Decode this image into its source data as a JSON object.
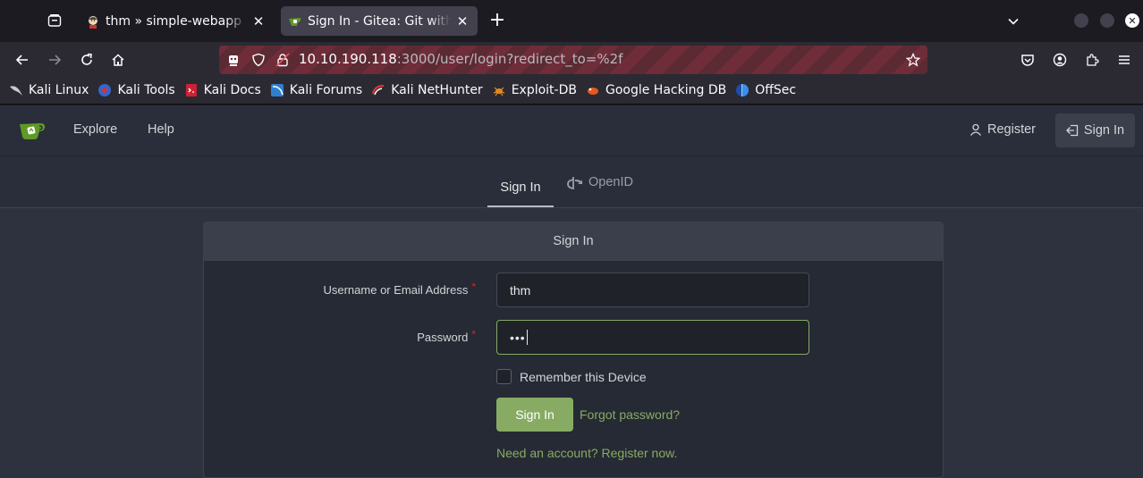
{
  "browser": {
    "tabs": [
      {
        "title": "thm » simple-webapp » m",
        "active": false,
        "icon": "jenkins-icon"
      },
      {
        "title": "Sign In - Gitea: Git with a cup of tea",
        "active": true,
        "icon": "gitea-icon"
      }
    ],
    "close_glyph": "✕",
    "new_tab_glyph": "+",
    "url": {
      "host": "10.10.190.118",
      "rest": ":3000/user/login?redirect_to=%2f"
    },
    "bookmarks": [
      {
        "label": "Kali Linux",
        "icon": "kali-dragon-icon"
      },
      {
        "label": "Kali Tools",
        "icon": "kali-tools-icon"
      },
      {
        "label": "Kali Docs",
        "icon": "kali-docs-icon"
      },
      {
        "label": "Kali Forums",
        "icon": "kali-forums-icon"
      },
      {
        "label": "Kali NetHunter",
        "icon": "kali-nethunter-icon"
      },
      {
        "label": "Exploit-DB",
        "icon": "exploit-db-icon"
      },
      {
        "label": "Google Hacking DB",
        "icon": "ghdb-icon"
      },
      {
        "label": "OffSec",
        "icon": "offsec-icon"
      }
    ]
  },
  "gitea": {
    "nav": {
      "explore": "Explore",
      "help": "Help",
      "register": "Register",
      "sign_in": "Sign In"
    },
    "subtabs": {
      "sign_in": "Sign In",
      "openid": "OpenID"
    },
    "form": {
      "header": "Sign In",
      "username_label": "Username or Email Address",
      "username_value": "thm",
      "password_label": "Password",
      "password_mask": "•••",
      "required_mark": "*",
      "remember": "Remember this Device",
      "submit": "Sign In",
      "forgot": "Forgot password?",
      "need_account": "Need an account? Register now."
    }
  },
  "colors": {
    "accent": "#87ab63",
    "required": "#db2828",
    "page_bg": "#2e323e"
  }
}
